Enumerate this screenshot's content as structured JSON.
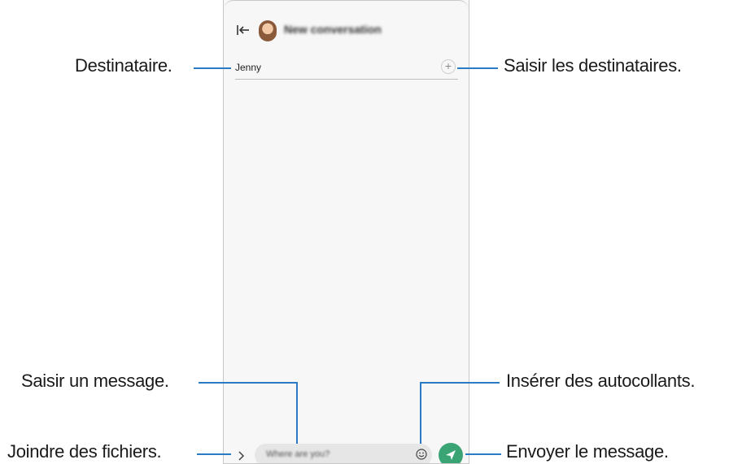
{
  "screen": {
    "title": "New conversation",
    "recipient": "Jenny",
    "message_placeholder": "Where are you?"
  },
  "callouts": {
    "recipient": "Destinataire.",
    "enter_recipients": "Saisir les destinataires.",
    "enter_message": "Saisir un message.",
    "insert_stickers": "Insérer des autocollants.",
    "attach_files": "Joindre des fichiers.",
    "send_message": "Envoyer le message."
  },
  "icons": {
    "back": "back-to-start-icon",
    "add": "plus-icon",
    "attach": "chevron-right-icon",
    "emoji": "smiley-icon",
    "send": "send-arrow-icon"
  },
  "colors": {
    "callout_line": "#2a7bc4",
    "send_button": "#3ba474"
  }
}
